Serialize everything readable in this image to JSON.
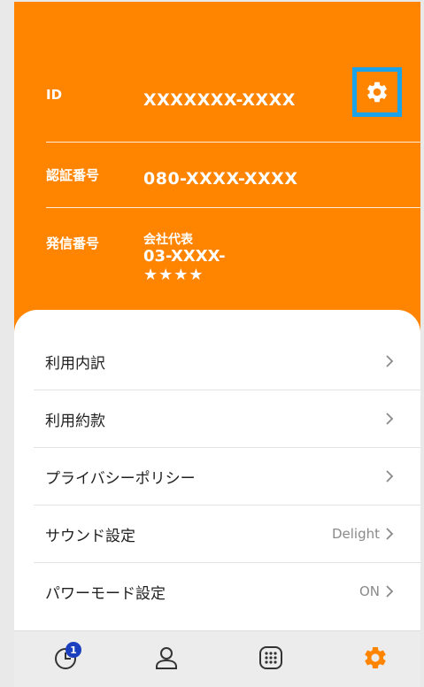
{
  "header": {
    "id_label": "ID",
    "id_value": "XXXXXXX-XXXX",
    "auth_label": "認証番号",
    "auth_value": "080-XXXX-XXXX",
    "sender_label": "発信番号",
    "sender_company": "会社代表",
    "sender_number": "03-XXXX-",
    "sender_stars": "★★★★",
    "settings_icon": "gear-icon"
  },
  "menu": {
    "items": [
      {
        "label": "利用内訳",
        "value": ""
      },
      {
        "label": "利用約款",
        "value": ""
      },
      {
        "label": "プライバシーポリシー",
        "value": ""
      },
      {
        "label": "サウンド設定",
        "value": "Delight"
      },
      {
        "label": "パワーモード設定",
        "value": "ON"
      }
    ]
  },
  "tabbar": {
    "tabs": [
      {
        "icon": "history-icon",
        "badge": "1"
      },
      {
        "icon": "contacts-icon"
      },
      {
        "icon": "dialpad-icon"
      },
      {
        "icon": "settings-gear-icon"
      }
    ]
  },
  "colors": {
    "accent": "#ff8500",
    "highlight_border": "#1aa3e8",
    "badge": "#1b3fbf"
  }
}
